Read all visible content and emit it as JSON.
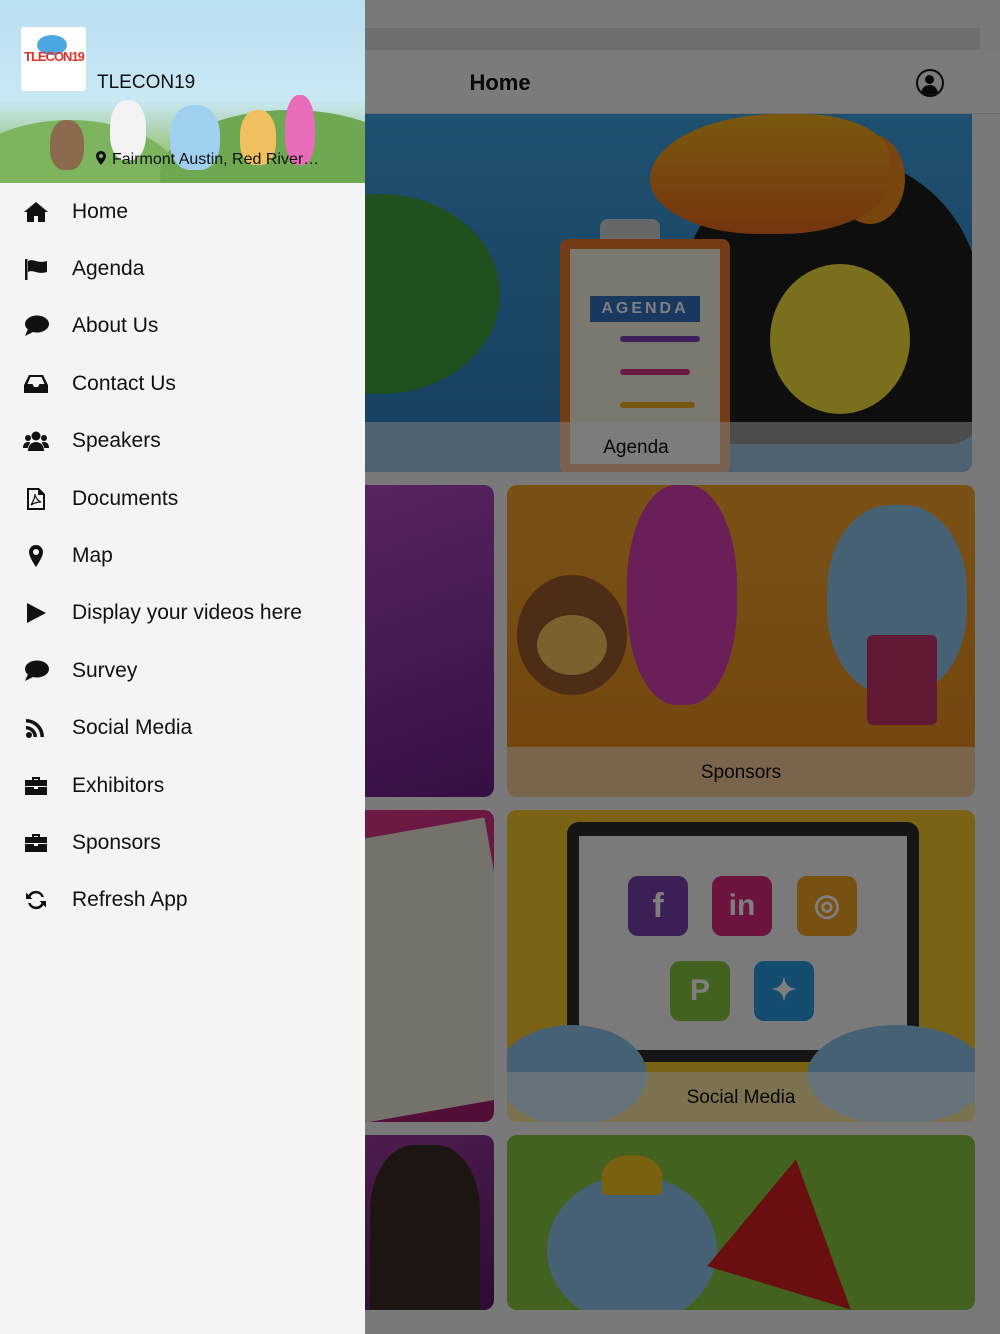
{
  "navbar": {
    "title": "Home"
  },
  "drawer": {
    "app_name": "TLECON19",
    "logo_text": "TLECON19",
    "location": "Fairmont Austin, Red River…",
    "menu": [
      {
        "label": "Home",
        "icon": "home-icon"
      },
      {
        "label": "Agenda",
        "icon": "flag-icon"
      },
      {
        "label": "About Us",
        "icon": "comment-icon"
      },
      {
        "label": "Contact Us",
        "icon": "inbox-icon"
      },
      {
        "label": "Speakers",
        "icon": "users-icon"
      },
      {
        "label": "Documents",
        "icon": "pdf-file-icon"
      },
      {
        "label": "Map",
        "icon": "map-marker-icon"
      },
      {
        "label": "Display your videos here",
        "icon": "play-icon"
      },
      {
        "label": "Survey",
        "icon": "comment-icon"
      },
      {
        "label": "Social Media",
        "icon": "rss-icon"
      },
      {
        "label": "Exhibitors",
        "icon": "briefcase-icon"
      },
      {
        "label": "Sponsors",
        "icon": "briefcase-icon"
      },
      {
        "label": "Refresh App",
        "icon": "refresh-icon"
      }
    ]
  },
  "tiles": {
    "agenda": {
      "label": "Agenda",
      "badge": "AGENDA"
    },
    "sponsors": {
      "label": "Sponsors"
    },
    "social_media": {
      "label": "Social Media"
    }
  },
  "colors": {
    "drawer_bg": "#f4f4f4",
    "overlay": "rgba(0,0,0,0.5)",
    "agenda_tile": "#3fa0e0",
    "sponsors_tile": "#f3a32b",
    "social_tile": "#f5c62a",
    "bottom_tile": "#87c440"
  }
}
